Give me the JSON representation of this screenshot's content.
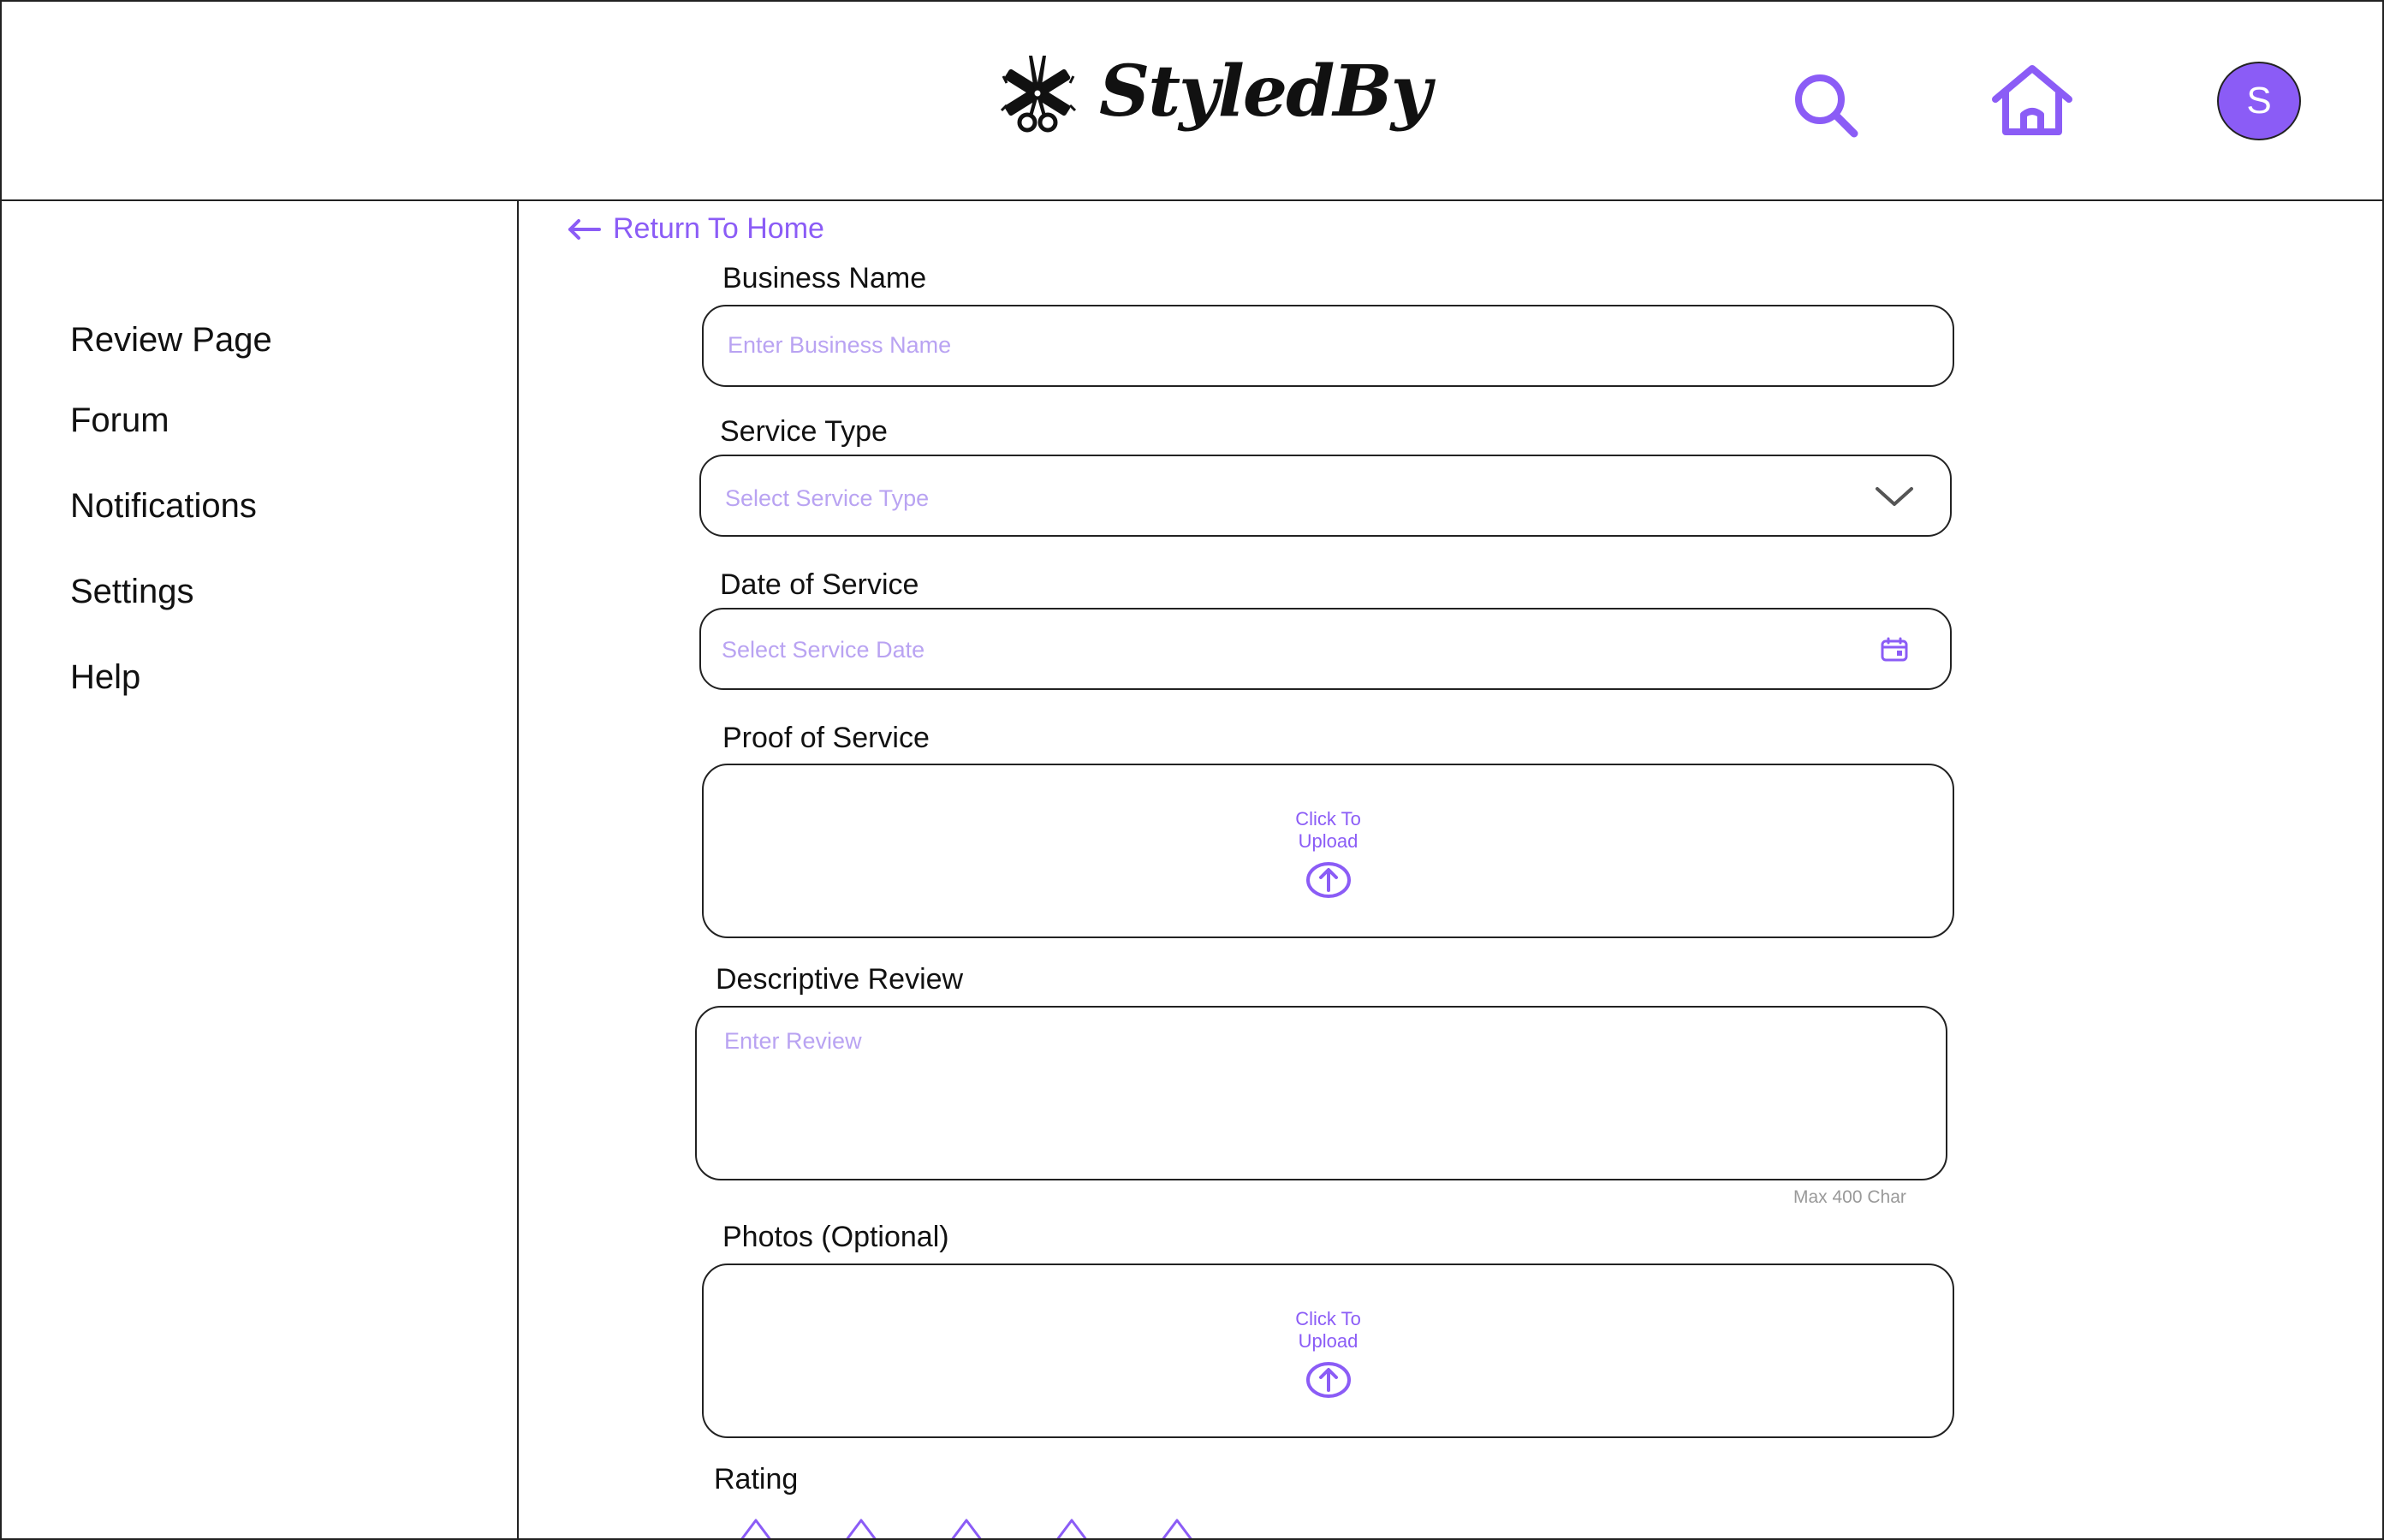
{
  "header": {
    "logo_text": "StyledBy",
    "avatar_initial": "S"
  },
  "sidebar": {
    "items": [
      {
        "label": "Review Page"
      },
      {
        "label": "Forum"
      },
      {
        "label": "Notifications"
      },
      {
        "label": "Settings"
      },
      {
        "label": "Help"
      }
    ]
  },
  "main": {
    "return_label": "Return To Home",
    "business_name": {
      "label": "Business Name",
      "placeholder": "Enter Business Name",
      "value": ""
    },
    "service_type": {
      "label": "Service Type",
      "placeholder": "Select Service Type",
      "value": ""
    },
    "date_of_service": {
      "label": "Date of Service",
      "placeholder": "Select Service Date",
      "value": ""
    },
    "proof_of_service": {
      "label": "Proof of Service",
      "upload_text": "Click To Upload"
    },
    "descriptive_review": {
      "label": "Descriptive Review",
      "placeholder": "Enter Review",
      "limit": "Max 400 Char"
    },
    "photos": {
      "label": "Photos (Optional)",
      "upload_text": "Click To Upload"
    },
    "rating": {
      "label": "Rating",
      "max_stars": 5,
      "value": 0
    }
  },
  "colors": {
    "accent": "#8b5cf6",
    "placeholder": "#b9a3f2",
    "border": "#222222"
  }
}
